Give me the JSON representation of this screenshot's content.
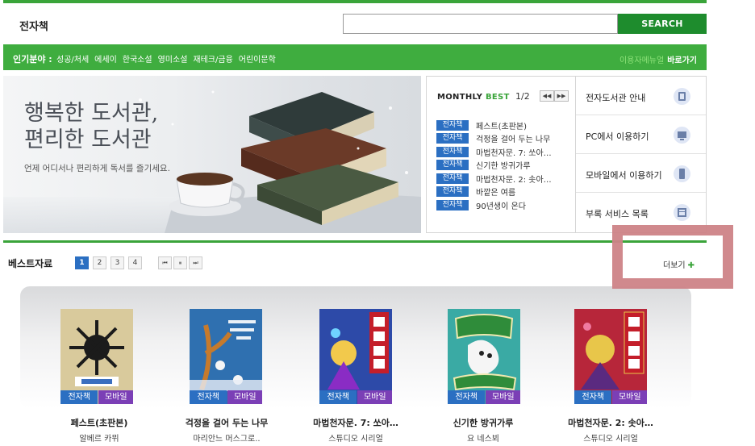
{
  "header": {
    "title": "전자책",
    "search_placeholder": "",
    "search_button": "SEARCH"
  },
  "category_bar": {
    "label": "인기분야 :",
    "items": [
      "성공/처세",
      "에세이",
      "한국소설",
      "영미소설",
      "재테크/금융",
      "어린이문학"
    ],
    "right_faint": "이용자메뉴얼",
    "right_link": "바로가기"
  },
  "banner": {
    "headline_line1": "행복한 도서관,",
    "headline_line2": "편리한 도서관",
    "subtitle": "언제 어디서나 편리하게 독서를 즐기세요."
  },
  "monthly_best": {
    "label_a": "MONTHLY",
    "label_b": "BEST",
    "page": "1/2",
    "prev_icon": "prev-arrow-icon",
    "next_icon": "next-arrow-icon",
    "tag": "전자책",
    "items": [
      "페스트(초판본)",
      "걱정을 걸어 두는 나무",
      "마법천자문. 7: 쏘아…",
      "신기한 방귀가루",
      "마법천자문. 2: 솟아…",
      "바깥은 여름",
      "90년생이 온다"
    ]
  },
  "services": [
    {
      "label": "전자도서관 안내",
      "icon": "library-guide-icon"
    },
    {
      "label": "PC에서 이용하기",
      "icon": "monitor-icon"
    },
    {
      "label": "모바일에서 이용하기",
      "icon": "mobile-icon"
    },
    {
      "label": "부록 서비스 목록",
      "icon": "list-icon"
    }
  ],
  "best_section": {
    "title": "베스트자료",
    "pages": [
      "1",
      "2",
      "3",
      "4"
    ],
    "active_page": "1",
    "more_label": "더보기",
    "more_plus": "✚",
    "controls": [
      "⏮",
      "⏸",
      "⏭"
    ],
    "books": [
      {
        "title": "페스트(초판본)",
        "author": "알베르 카뮈",
        "tag_ebook": "전자책",
        "tag_mobile": "모바일",
        "cover_bg": "#d8c99a",
        "cover_accent": "#1b1b1b"
      },
      {
        "title": "걱정을 걸어 두는 나무",
        "author": "마리안느 머스그로..",
        "tag_ebook": "전자책",
        "tag_mobile": "모바일",
        "cover_bg": "#2f6fae",
        "cover_accent": "#c67a2c"
      },
      {
        "title": "마법천자문. 7: 쏘아…",
        "author": "스튜디오 시리얼",
        "tag_ebook": "전자책",
        "tag_mobile": "모바일",
        "cover_bg": "#2d4aa8",
        "cover_accent": "#c41e2a"
      },
      {
        "title": "신기한 방귀가루",
        "author": "요 네스뵈",
        "tag_ebook": "전자책",
        "tag_mobile": "모바일",
        "cover_bg": "#3aa9a3",
        "cover_accent": "#f0e9b0"
      },
      {
        "title": "마법천자문. 2: 솟아…",
        "author": "스튜디오 시리얼",
        "tag_ebook": "전자책",
        "tag_mobile": "모바일",
        "cover_bg": "#b8263a",
        "cover_accent": "#e8c64a"
      }
    ]
  }
}
